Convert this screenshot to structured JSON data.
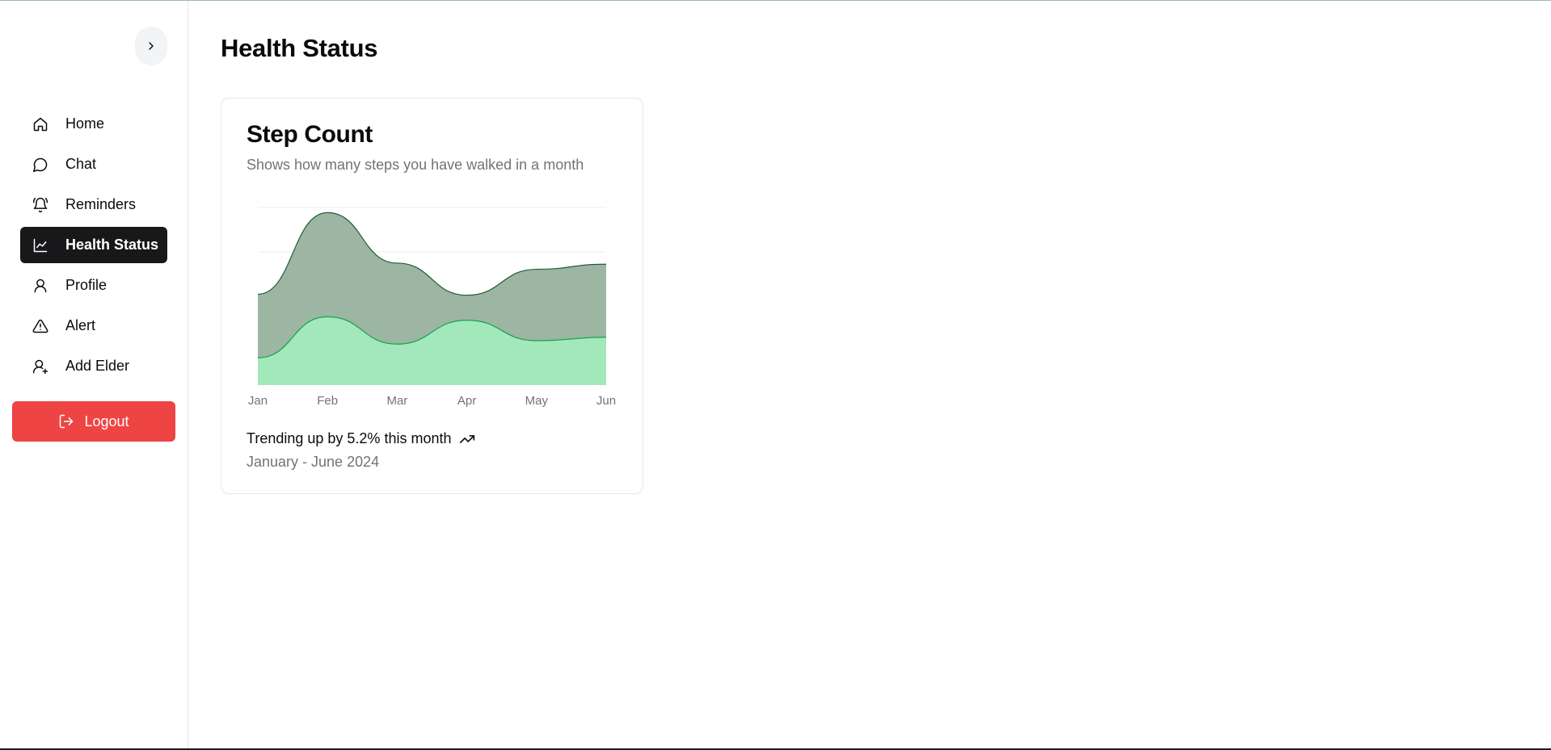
{
  "sidebar": {
    "toggle_icon": "chevron-right-icon",
    "items": [
      {
        "label": "Home",
        "icon": "home-icon",
        "active": false
      },
      {
        "label": "Chat",
        "icon": "chat-icon",
        "active": false
      },
      {
        "label": "Reminders",
        "icon": "bell-icon",
        "active": false
      },
      {
        "label": "Health Status",
        "icon": "line-chart-icon",
        "active": true
      },
      {
        "label": "Profile",
        "icon": "user-icon",
        "active": false
      },
      {
        "label": "Alert",
        "icon": "alert-triangle-icon",
        "active": false
      },
      {
        "label": "Add Elder",
        "icon": "user-plus-icon",
        "active": false
      }
    ],
    "logout_label": "Logout",
    "logout_icon": "logout-icon"
  },
  "page": {
    "title": "Health Status"
  },
  "card": {
    "title": "Step Count",
    "description": "Shows how many steps you have walked in a month",
    "trend_text": "Trending up by 5.2% this month",
    "trend_icon": "trending-up-icon",
    "range_text": "January - June 2024"
  },
  "colors": {
    "active_nav_bg": "#18181b",
    "logout_bg": "#ef4444",
    "series_dark": "#1f5e36",
    "series_dark_fill": "#9db5a3",
    "series_light": "#16a34a",
    "series_light_fill": "#a3e8bb"
  },
  "chart_data": {
    "type": "area",
    "stacked": true,
    "categories": [
      "Jan",
      "Feb",
      "Mar",
      "Apr",
      "May",
      "Jun"
    ],
    "series": [
      {
        "values": [
          80,
          200,
          120,
          190,
          130,
          140
        ]
      },
      {
        "values": [
          186,
          305,
          237,
          73,
          209,
          214
        ]
      }
    ],
    "ylim": [
      0,
      520
    ],
    "grid": true,
    "legend": "none"
  }
}
